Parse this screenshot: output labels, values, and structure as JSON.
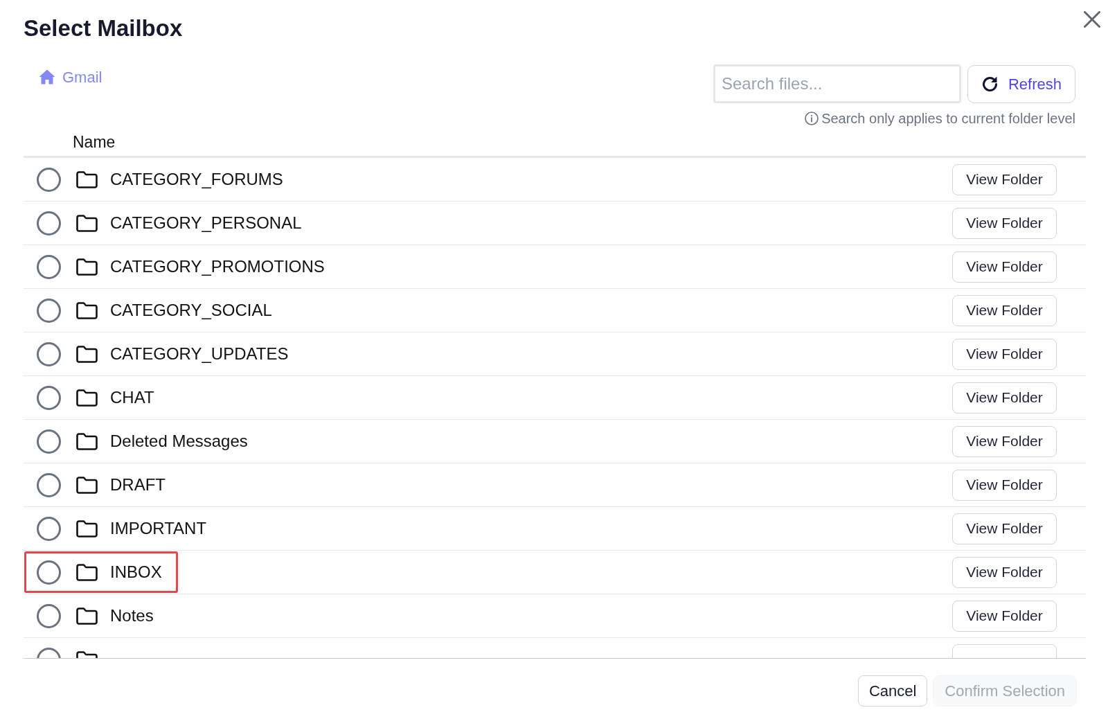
{
  "dialog": {
    "title": "Select Mailbox"
  },
  "breadcrumb": {
    "label": "Gmail"
  },
  "search": {
    "placeholder": "Search files...",
    "hint": "Search only applies to current folder level"
  },
  "refresh_button": {
    "label": "Refresh"
  },
  "table": {
    "columns": [
      "Name"
    ],
    "rows": [
      {
        "name": "CATEGORY_FORUMS",
        "action": "View Folder",
        "selected": false,
        "highlighted": false
      },
      {
        "name": "CATEGORY_PERSONAL",
        "action": "View Folder",
        "selected": false,
        "highlighted": false
      },
      {
        "name": "CATEGORY_PROMOTIONS",
        "action": "View Folder",
        "selected": false,
        "highlighted": false
      },
      {
        "name": "CATEGORY_SOCIAL",
        "action": "View Folder",
        "selected": false,
        "highlighted": false
      },
      {
        "name": "CATEGORY_UPDATES",
        "action": "View Folder",
        "selected": false,
        "highlighted": false
      },
      {
        "name": "CHAT",
        "action": "View Folder",
        "selected": false,
        "highlighted": false
      },
      {
        "name": "Deleted Messages",
        "action": "View Folder",
        "selected": false,
        "highlighted": false
      },
      {
        "name": "DRAFT",
        "action": "View Folder",
        "selected": false,
        "highlighted": false
      },
      {
        "name": "IMPORTANT",
        "action": "View Folder",
        "selected": false,
        "highlighted": false
      },
      {
        "name": "INBOX",
        "action": "View Folder",
        "selected": false,
        "highlighted": true
      },
      {
        "name": "Notes",
        "action": "View Folder",
        "selected": false,
        "highlighted": false
      },
      {
        "selected": false,
        "highlighted": false
      }
    ]
  },
  "footer": {
    "buttons": [
      {
        "label": "Cancel",
        "kind": "secondary",
        "disabled": false
      },
      {
        "label": "Confirm Selection",
        "kind": "primary",
        "disabled": true
      }
    ]
  }
}
